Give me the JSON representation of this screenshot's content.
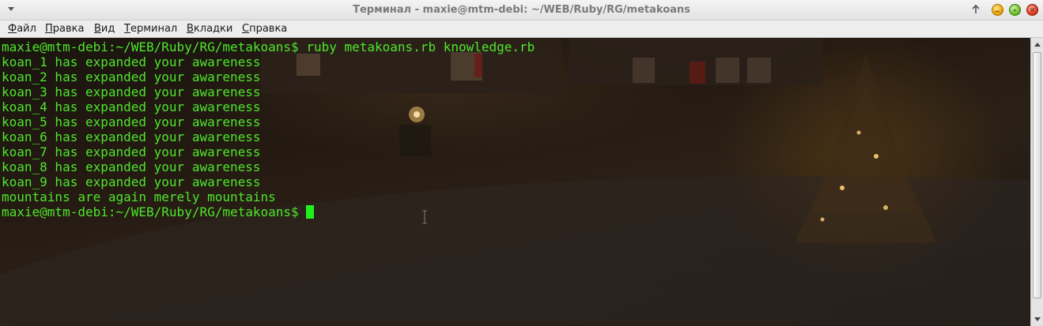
{
  "window": {
    "title": "Терминал - maxie@mtm-debi: ~/WEB/Ruby/RG/metakoans"
  },
  "menubar": {
    "items": [
      "Файл",
      "Правка",
      "Вид",
      "Терминал",
      "Вкладки",
      "Справка"
    ]
  },
  "terminal": {
    "lines": [
      "maxie@mtm-debi:~/WEB/Ruby/RG/metakoans$ ruby metakoans.rb knowledge.rb",
      "koan_1 has expanded your awareness",
      "koan_2 has expanded your awareness",
      "koan_3 has expanded your awareness",
      "koan_4 has expanded your awareness",
      "koan_5 has expanded your awareness",
      "koan_6 has expanded your awareness",
      "koan_7 has expanded your awareness",
      "koan_8 has expanded your awareness",
      "koan_9 has expanded your awareness",
      "mountains are again merely mountains"
    ],
    "prompt": "maxie@mtm-debi:~/WEB/Ruby/RG/metakoans$ "
  },
  "colors": {
    "text": "#4ee62b",
    "cursor": "#1ef21e",
    "close_button": "#e0361d",
    "minimize_button": "#f0a600",
    "maximize_button": "#6cbf2a"
  },
  "icons": {
    "window_menu": "chevron-down-icon",
    "keep_above": "arrow-up-icon",
    "minimize": "minimize-icon",
    "maximize": "maximize-icon",
    "close": "close-icon"
  }
}
